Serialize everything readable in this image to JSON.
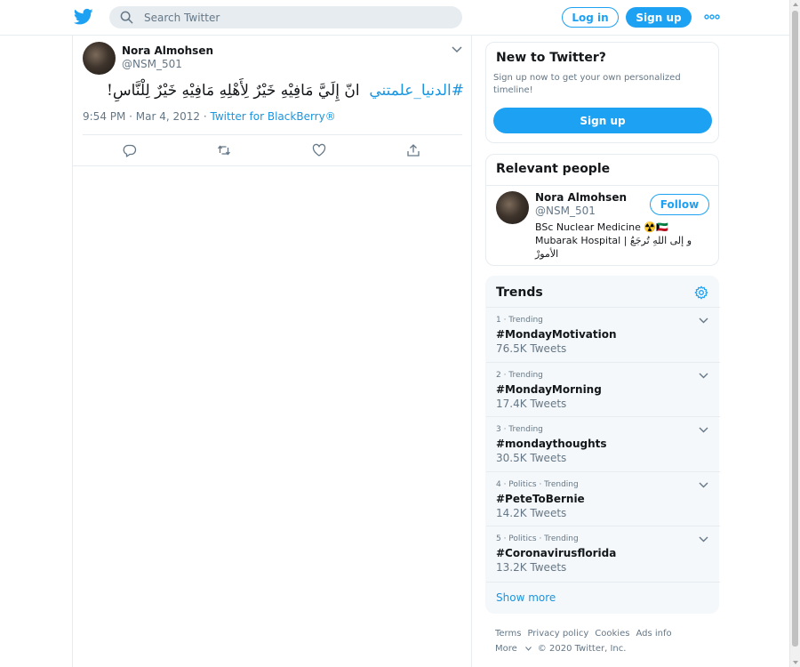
{
  "topbar": {
    "search_placeholder": "Search Twitter",
    "login_label": "Log in",
    "signup_label": "Sign up",
    "more_icon": "more-dots-icon"
  },
  "tweet": {
    "author_name": "Nora Almohsen",
    "author_handle": "@NSM_501",
    "hashtag": "#الدنيا_علمتني",
    "text": "انّ إِلَيَّ مَافِيْهِ خَيْرٌ لِأَهْلِهِ مَافِيْهِ خَيْرٌ لِلْنَّاسِ!",
    "timestamp": "9:54 PM · Mar 4, 2012",
    "source_sep": " · ",
    "source": "Twitter for BlackBerry®",
    "actions": [
      "reply-icon",
      "retweet-icon",
      "like-icon",
      "share-icon"
    ]
  },
  "new_to_twitter": {
    "title": "New to Twitter?",
    "description": "Sign up now to get your own personalized timeline!",
    "signup_label": "Sign up"
  },
  "relevant_people": {
    "title": "Relevant people",
    "name": "Nora Almohsen",
    "handle": "@NSM_501",
    "follow_label": "Follow",
    "bio_line1": "BSc Nuclear Medicine ☢️🇰🇼",
    "bio_line2": "Mubarak Hospital | و إلى اللهِ تُرجَعُ الأمورْ"
  },
  "trends": {
    "title": "Trends",
    "items": [
      {
        "meta": "1 · Trending",
        "name": "#MondayMotivation",
        "count": "76.5K Tweets"
      },
      {
        "meta": "2 · Trending",
        "name": "#MondayMorning",
        "count": "17.4K Tweets"
      },
      {
        "meta": "3 · Trending",
        "name": "#mondaythoughts",
        "count": "30.5K Tweets"
      },
      {
        "meta": "4 · Politics · Trending",
        "name": "#PeteToBernie",
        "count": "14.2K Tweets"
      },
      {
        "meta": "5 · Politics · Trending",
        "name": "#Coronavirusflorida",
        "count": "13.2K Tweets"
      }
    ],
    "show_more": "Show more"
  },
  "footer": {
    "links": [
      "Terms",
      "Privacy policy",
      "Cookies",
      "Ads info"
    ],
    "more_label": "More",
    "copyright": "© 2020 Twitter, Inc."
  },
  "colors": {
    "accent": "#1da1f2",
    "link": "#1b95e0",
    "muted": "#657786",
    "border": "#e6ecf0"
  }
}
